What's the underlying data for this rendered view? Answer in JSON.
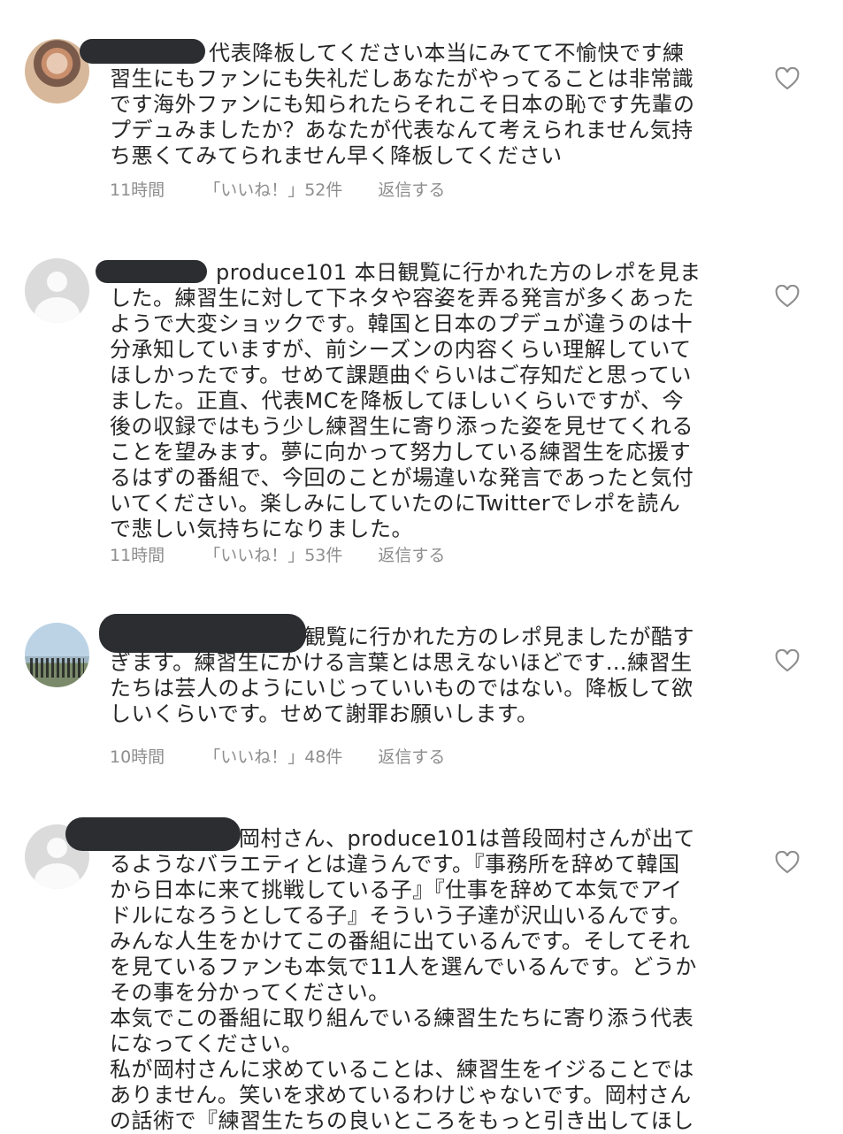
{
  "comments": [
    {
      "text": "代表降板してください本当にみてて不愉快です練\n習生にもファンにも失礼だしあなたがやってることは非常識\nです海外ファンにも知られたらそれこそ日本の恥です先輩の\nプデュみましたか？あなたが代表なんて考えられません気持\nち悪くてみてられません早く降板してください",
      "time": "11時間",
      "likes": "「いいね！」52件",
      "reply": "返信する"
    },
    {
      "text": "produce101 本日観覧に行かれた方のレポを見ま\nした。練習生に対して下ネタや容姿を弄る発言が多くあった\nようで大変ショックです。韓国と日本のプデュが違うのは十\n分承知していますが、前シーズンの内容くらい理解していて\nほしかったです。せめて課題曲ぐらいはご存知だと思ってい\nました。正直、代表MCを降板してほしいくらいですが、今\n後の収録ではもう少し練習生に寄り添った姿を見せてくれる\nことを望みます。夢に向かって努力している練習生を応援す\nるはずの番組で、今回のことが場違いな発言であったと気付\nいてください。楽しみにしていたのにTwitterでレポを読ん\nで悲しい気持ちになりました。",
      "time": "11時間",
      "likes": "「いいね！」53件",
      "reply": "返信する"
    },
    {
      "text": "観覧に行かれた方のレポ見ましたが酷す\nぎます。練習生にかける言葉とは思えないほどです…練習生\nたちは芸人のようにいじっていいものではない。降板して欲\nしいくらいです。せめて謝罪お願いします。",
      "time": "10時間",
      "likes": "「いいね！」48件",
      "reply": "返信する"
    },
    {
      "text": "岡村さん、produce101は普段岡村さんが出て\nるようなバラエティとは違うんです。『事務所を辞めて韓国\nから日本に来て挑戦している子』『仕事を辞めて本気でアイ\nドルになろうとしてる子』そういう子達が沢山いるんです。\nみんな人生をかけてこの番組に出ているんです。そしてそれ\nを見ているファンも本気で11人を選んでいるんです。どうか\nその事を分かってください。\n本気でこの番組に取り組んでいる練習生たちに寄り添う代表\nになってください。\n私が岡村さんに求めていることは、練習生をイジることでは\nありません。笑いを求めているわけじゃないです。岡村さん\nの話術で『練習生たちの良いところをもっと引き出してほし"
    }
  ],
  "icons": {
    "like": "heart-outline-icon",
    "avatar_default": "default-avatar-icon"
  },
  "colors": {
    "text": "#262626",
    "meta": "#8e8e8e",
    "redaction": "#2b2d30",
    "placeholder": "#dbdbdb"
  }
}
